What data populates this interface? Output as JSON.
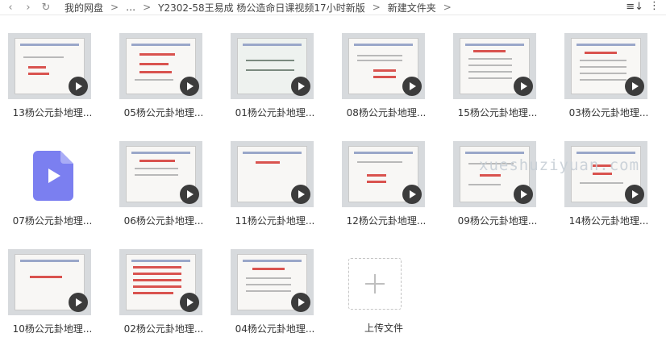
{
  "nav": {
    "back": "‹",
    "forward": "›",
    "refresh": "↻",
    "crumbs": [
      "我的网盘",
      "…",
      "Y2302-58王易成 杨公造命日课视频17小时新版",
      "新建文件夹"
    ],
    "separator": ">",
    "sort": "≡↓",
    "more": "⋮"
  },
  "files": [
    "13杨公元卦地理...",
    "05杨公元卦地理...",
    "01杨公元卦地理...",
    "08杨公元卦地理...",
    "15杨公元卦地理...",
    "03杨公元卦地理...",
    "07杨公元卦地理...",
    "06杨公元卦地理...",
    "11杨公元卦地理...",
    "12杨公元卦地理...",
    "09杨公元卦地理...",
    "14杨公元卦地理...",
    "10杨公元卦地理...",
    "02杨公元卦地理...",
    "04杨公元卦地理..."
  ],
  "upload": {
    "label": "上传文件"
  },
  "watermark": "xueshuziyuan.com",
  "colors": {
    "play": "#3c3c3c",
    "file_icon": "#7b7ff0",
    "accent": "#d9534f"
  }
}
